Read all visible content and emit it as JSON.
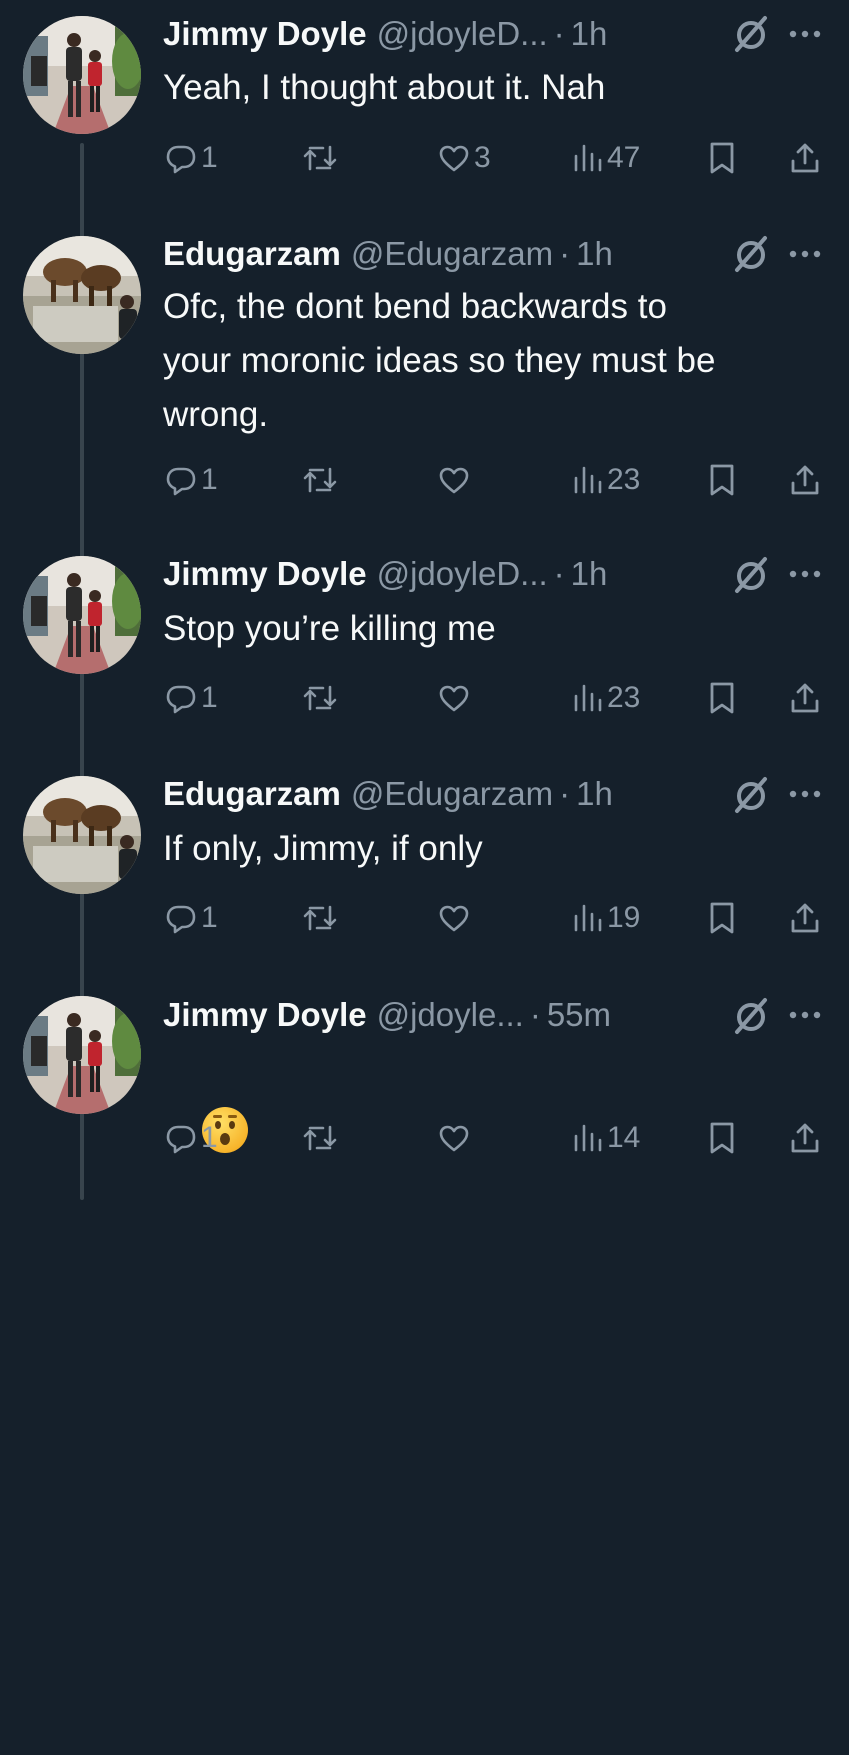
{
  "tweets": [
    {
      "name": "Jimmy Doyle",
      "handle": "@jdoyleD...",
      "dot": "·",
      "time": "1h",
      "text": "Yeah, I thought about it. Nah",
      "avatar": "jimmy-avatar",
      "stats": {
        "replies": "1",
        "retweets": "",
        "likes": "3",
        "views": "47"
      }
    },
    {
      "name": "Edugarzam",
      "handle": "@Edugarzam",
      "dot": "·",
      "time": "1h",
      "text": "Ofc, the dont bend backwards to\nyour moronic ideas so they must be\nwrong.",
      "avatar": "edu-avatar",
      "stats": {
        "replies": "1",
        "retweets": "",
        "likes": "",
        "views": "23"
      }
    },
    {
      "name": "Jimmy Doyle",
      "handle": "@jdoyleD...",
      "dot": "·",
      "time": "1h",
      "text": "Stop you’re killing me",
      "avatar": "jimmy-avatar",
      "stats": {
        "replies": "1",
        "retweets": "",
        "likes": "",
        "views": "23"
      }
    },
    {
      "name": "Edugarzam",
      "handle": "@Edugarzam",
      "dot": "·",
      "time": "1h",
      "text": "If only, Jimmy, if only",
      "avatar": "edu-avatar",
      "stats": {
        "replies": "1",
        "retweets": "",
        "likes": "",
        "views": "19"
      }
    },
    {
      "name": "Jimmy Doyle",
      "handle": "@jdoyle...",
      "dot": "·",
      "time": "55m",
      "text": "",
      "emoji": "hushed-face-emoji",
      "avatar": "jimmy-avatar",
      "stats": {
        "replies": "1",
        "retweets": "",
        "likes": "",
        "views": "14"
      }
    }
  ],
  "icons": {
    "grok": "grok-slash-icon",
    "more": "more-dots-icon",
    "reply": "reply-icon",
    "retweet": "retweet-icon",
    "like": "heart-icon",
    "views": "views-icon",
    "bookmark": "bookmark-icon",
    "share": "share-icon"
  },
  "colors": {
    "background": "#15202b",
    "text": "#f7f9f9",
    "secondary": "#8b98a5",
    "thread": "#38444d"
  }
}
